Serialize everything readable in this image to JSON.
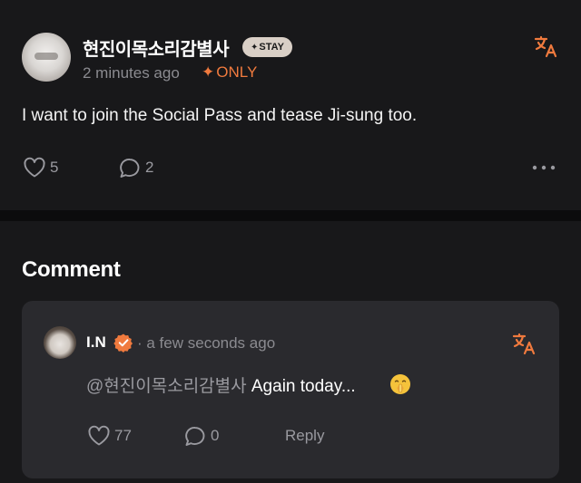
{
  "colors": {
    "background": "#18181a",
    "card": "#2a2a2e",
    "accent_orange": "#f07a3e",
    "muted": "#9a9aa0",
    "badge_bg": "#d9cfc6"
  },
  "post": {
    "author": "현진이목소리감별사",
    "badge": "STAY",
    "time": "2 minutes ago",
    "visibility": "ONLY",
    "body": "I want to join the Social Pass and tease Ji-sung too.",
    "likes": "5",
    "comments": "2",
    "icons": [
      "translate-icon",
      "heart-icon",
      "comment-bubble-icon",
      "more-icon"
    ]
  },
  "comments_section": {
    "heading": "Comment",
    "items": [
      {
        "author": "I.N",
        "time": "· a few seconds ago",
        "mention": "@현진이목소리감별사",
        "text": " Again today...",
        "likes": "77",
        "replies": "0",
        "reply_label": "Reply",
        "icons": [
          "verified-icon",
          "translate-icon",
          "shushing-face-emoji-icon",
          "heart-icon",
          "comment-bubble-icon"
        ]
      }
    ]
  }
}
